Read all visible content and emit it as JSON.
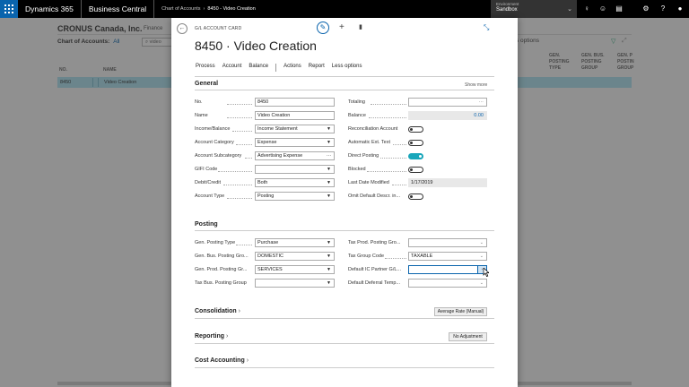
{
  "topbar": {
    "app": "Dynamics 365",
    "product": "Business Central",
    "crumbs": [
      "Chart of Accounts",
      "8450 - Video Creation"
    ],
    "env_label": "Environment",
    "env_value": "Sandbox",
    "icons": [
      "waffle-icon",
      "lightbulb-icon",
      "smiley-icon",
      "chat-icon",
      "gear-icon",
      "help-icon",
      "user-icon"
    ]
  },
  "background": {
    "company": "CRONUS Canada, Inc.",
    "nav": "Finance",
    "list_title": "Chart of Accounts:",
    "filter": "All",
    "search": "video",
    "right_text": "s options",
    "col_no": "NO.",
    "col_name": "NAME",
    "cols": [
      [
        "GEN.",
        "POSTING",
        "TYPE"
      ],
      [
        "GEN. BUS.",
        "POSTING",
        "GROUP"
      ],
      [
        "GEN. P",
        "POSTIN",
        "GROUP"
      ]
    ],
    "row": {
      "no": "8450",
      "name": "Video Creation"
    }
  },
  "card": {
    "label": "G/L ACCOUNT CARD",
    "title": "8450 · Video Creation",
    "actions": [
      "Process",
      "Account",
      "Balance",
      "Actions",
      "Report",
      "Less options"
    ],
    "general": {
      "heading": "General",
      "show_more": "Show more",
      "left": [
        {
          "label": "No.",
          "value": "8450",
          "kind": "text"
        },
        {
          "label": "Name",
          "value": "Video Creation",
          "kind": "text"
        },
        {
          "label": "Income/Balance",
          "value": "Income Statement",
          "kind": "select"
        },
        {
          "label": "Account Category",
          "value": "Expense",
          "kind": "select"
        },
        {
          "label": "Account Subcategory",
          "value": "Advertising Expense",
          "kind": "lookup"
        },
        {
          "label": "GIFI Code",
          "value": "",
          "kind": "select"
        },
        {
          "label": "Debit/Credit",
          "value": "Both",
          "kind": "select"
        },
        {
          "label": "Account Type",
          "value": "Posting",
          "kind": "select"
        }
      ],
      "right": [
        {
          "label": "Totaling",
          "value": "···",
          "kind": "text"
        },
        {
          "label": "Balance",
          "value": "0.00",
          "kind": "readonly"
        },
        {
          "label": "Reconciliation Account",
          "value": "off",
          "kind": "toggle"
        },
        {
          "label": "Automatic Ext. Text",
          "value": "off",
          "kind": "toggle"
        },
        {
          "label": "Direct Posting",
          "value": "on",
          "kind": "toggle"
        },
        {
          "label": "Blocked",
          "value": "off",
          "kind": "toggle"
        },
        {
          "label": "Last Date Modified",
          "value": "1/17/2019",
          "kind": "readonly"
        },
        {
          "label": "Omit Default Descr. in...",
          "value": "off",
          "kind": "toggle"
        }
      ]
    },
    "posting": {
      "heading": "Posting",
      "left": [
        {
          "label": "Gen. Posting Type",
          "value": "Purchase",
          "kind": "select"
        },
        {
          "label": "Gen. Bus. Posting Gro...",
          "value": "DOMESTIC",
          "kind": "select"
        },
        {
          "label": "Gen. Prod. Posting Gr...",
          "value": "SERVICES",
          "kind": "select"
        },
        {
          "label": "Tax Bus. Posting Group",
          "value": "",
          "kind": "select"
        }
      ],
      "right": [
        {
          "label": "Tax Prod. Posting Gro...",
          "value": "",
          "kind": "chevron"
        },
        {
          "label": "Tax Group Code",
          "value": "TAXABLE",
          "kind": "chevron"
        },
        {
          "label": "Default IC Partner G/L...",
          "value": "",
          "kind": "focus"
        },
        {
          "label": "Default Deferral Temp...",
          "value": "",
          "kind": "chevron"
        }
      ]
    },
    "consolidation": {
      "heading": "Consolidation",
      "badge": "Average Rate (Manual)"
    },
    "reporting": {
      "heading": "Reporting",
      "badge": "No Adjustment"
    },
    "cost": {
      "heading": "Cost Accounting"
    }
  }
}
